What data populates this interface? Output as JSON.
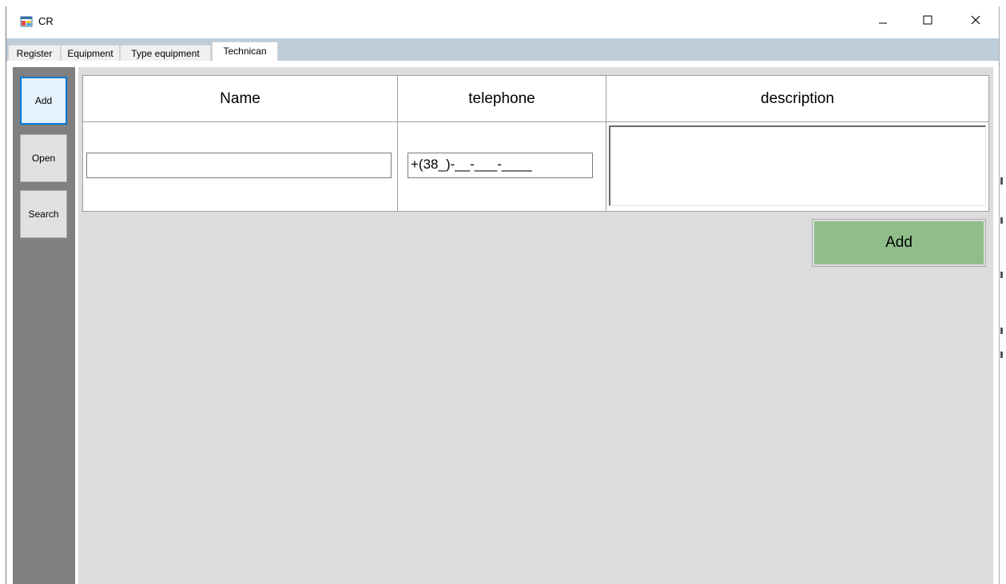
{
  "window": {
    "title": "CR",
    "minimize_symbol": "—",
    "maximize_symbol": "☐",
    "close_symbol": "✕"
  },
  "tabs": [
    {
      "label": "Register",
      "active": false
    },
    {
      "label": "Equipment",
      "active": false
    },
    {
      "label": "Type equipment",
      "active": false
    },
    {
      "label": "Technican",
      "active": true
    }
  ],
  "sidebar": {
    "buttons": [
      {
        "label": "Add",
        "focused": true
      },
      {
        "label": "Open",
        "focused": false
      },
      {
        "label": "Search",
        "focused": false
      }
    ]
  },
  "form": {
    "columns": [
      "Name",
      "telephone",
      "description"
    ],
    "name_value": "",
    "telephone_value": "+(38_)-__-___-____",
    "description_value": "",
    "add_button_label": "Add"
  },
  "colors": {
    "tabstrip_bg": "#bfcddb",
    "sidebar_bg": "#808080",
    "main_bg": "#dcdcdc",
    "add_button_bg": "#8fbe8b",
    "focus_border": "#0078d7"
  },
  "icons": {
    "app": "app-window-icon",
    "minimize": "minimize-icon",
    "maximize": "maximize-icon",
    "close": "close-icon"
  }
}
